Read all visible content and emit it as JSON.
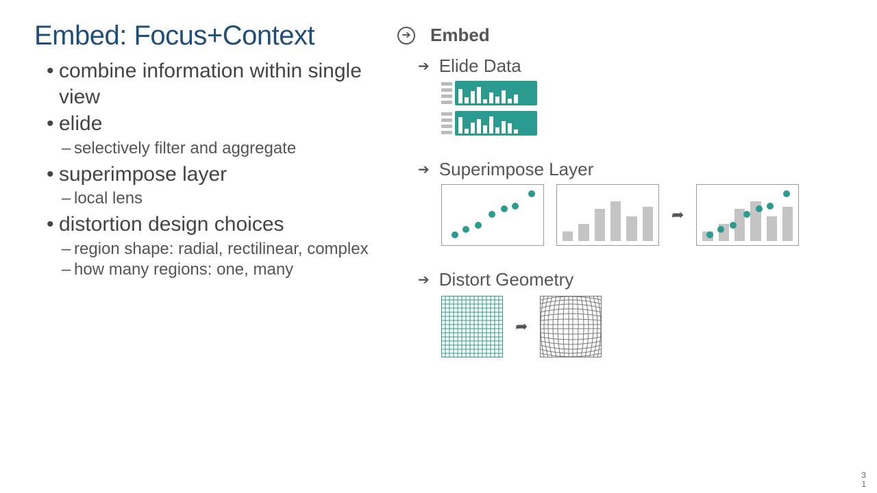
{
  "title": "Embed: Focus+Context",
  "bullets": {
    "b1": "combine information within single view",
    "b2": "elide",
    "b2s1": "selectively filter and aggregate",
    "b3": "superimpose layer",
    "b3s1": "local lens",
    "b4": "distortion design choices",
    "b4s1": "region shape: radial, rectilinear, complex",
    "b4s2": "how many regions: one, many"
  },
  "right": {
    "head": "Embed",
    "sec1": "Elide Data",
    "sec2": "Superimpose Layer",
    "sec3": "Distort Geometry"
  },
  "footer": {
    "line1": "3",
    "line2": "1"
  }
}
